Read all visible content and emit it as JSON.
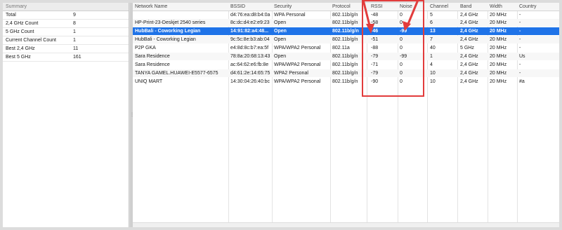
{
  "summary": {
    "title": "Summary",
    "rows": [
      {
        "label": "Total",
        "value": "9"
      },
      {
        "label": "2,4 GHz Count",
        "value": "8"
      },
      {
        "label": "5 GHz Count",
        "value": "1"
      },
      {
        "label": "Current Channel Count",
        "value": "1"
      },
      {
        "label": "Best 2,4 GHz",
        "value": "11"
      },
      {
        "label": "Best 5 GHz",
        "value": "161"
      }
    ]
  },
  "table": {
    "headers": {
      "name": "Network Name",
      "bssid": "BSSID",
      "security": "Security",
      "protocol": "Protocol",
      "rssi": "RSSI",
      "noise": "Noise",
      "channel": "Channel",
      "band": "Band",
      "width": "Width",
      "country": "Country"
    },
    "rows": [
      {
        "name": "",
        "bssid": "d4:76:ea:d8:b4:0a",
        "security": "WPA Personal",
        "protocol": "802.11b/g/n",
        "rssi": "-48",
        "noise": "0",
        "channel": "5",
        "band": "2,4 GHz",
        "width": "20 MHz",
        "country": "-"
      },
      {
        "name": "HP-Print-23-Deskjet 2540 series",
        "bssid": "8c:dc:d4:e2:e9:23",
        "security": "Open",
        "protocol": "802.11b/g/n",
        "rssi": "-58",
        "noise": "0",
        "channel": "6",
        "band": "2,4 GHz",
        "width": "20 MHz",
        "country": "-"
      },
      {
        "name": "HubBali - Coworking Legian",
        "bssid": "14:91:82:a4:48...",
        "security": "Open",
        "protocol": "802.11b/g/n",
        "rssi": "-46",
        "noise": "-99",
        "channel": "13",
        "band": "2,4 GHz",
        "width": "20 MHz",
        "country": "-"
      },
      {
        "name": "HubBali - Coworking Legian",
        "bssid": "9c:5c:8e:b3:ab:04",
        "security": "Open",
        "protocol": "802.11b/g/n",
        "rssi": "-51",
        "noise": "0",
        "channel": "7",
        "band": "2,4 GHz",
        "width": "20 MHz",
        "country": "-"
      },
      {
        "name": "P2P GKA",
        "bssid": "e4:8d:8c:b7:ea:5f",
        "security": "WPA/WPA2 Personal",
        "protocol": "802.11a",
        "rssi": "-88",
        "noise": "0",
        "channel": "40",
        "band": "5 GHz",
        "width": "20 MHz",
        "country": "-"
      },
      {
        "name": "Sara Residence",
        "bssid": "78:8a:20:68:13:43",
        "security": "Open",
        "protocol": "802.11b/g/n",
        "rssi": "-79",
        "noise": "-99",
        "channel": "1",
        "band": "2,4 GHz",
        "width": "20 MHz",
        "country": "Us"
      },
      {
        "name": "Sara Residence",
        "bssid": "ac:64:62:e6:fb:8e",
        "security": "WPA/WPA2 Personal",
        "protocol": "802.11b/g/n",
        "rssi": "-71",
        "noise": "0",
        "channel": "4",
        "band": "2,4 GHz",
        "width": "20 MHz",
        "country": "-"
      },
      {
        "name": "TANYA GAMEL.HUAWEI-E5577-6575",
        "bssid": "d4:61:2e:14:65:75",
        "security": "WPA2 Personal",
        "protocol": "802.11b/g/n",
        "rssi": "-79",
        "noise": "0",
        "channel": "10",
        "band": "2,4 GHz",
        "width": "20 MHz",
        "country": "-"
      },
      {
        "name": "UNIQ MART",
        "bssid": "14:30:04:26:40:bc",
        "security": "WPA/WPA2 Personal",
        "protocol": "802.11b/g/n",
        "rssi": "-90",
        "noise": "0",
        "channel": "10",
        "band": "2,4 GHz",
        "width": "20 MHz",
        "country": "#a"
      }
    ]
  },
  "colors": {
    "selection": "#1f73e8",
    "annotation": "#e23c3c"
  }
}
